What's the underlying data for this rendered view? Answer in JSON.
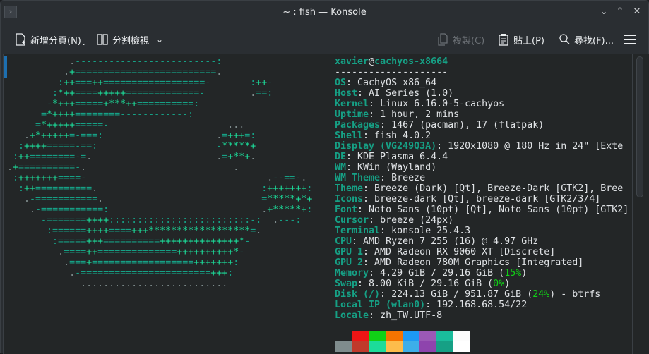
{
  "window": {
    "title": "~ : fish — Konsole",
    "menu_icon": "chevron-right-icon",
    "controls": [
      "minimize",
      "maximize",
      "close"
    ]
  },
  "toolbar": {
    "new_tab": "新增分頁(N)",
    "split_view": "分割檢視",
    "copy": "複製(C)",
    "paste": "貼上(P)",
    "find": "尋找(F)..."
  },
  "art": [
    "           .-------------------------:",
    "          .+=========================.",
    "         :++===++==================-       :++-",
    "        :*++====+++++=============-        .==:",
    "       -*+++=====+***++==========:",
    "      =*++++========------------:",
    "     =*+++++=====-                     ...",
    "   .+*+++++=-===:                    .=+++=:",
    "  :++++=====-==:                     -*****+",
    " :++========-=.                      .=+**+.",
    ".+==========-.                          .",
    " :+++++++====-                                .--==-.",
    "  :++==========.                             :+++++++:",
    "   .-===========.                            =*****+*+",
    "    .-===========:                           .+*****+:",
    "      -=======++++:::::::::::::::::::::::::-:  .---:",
    "       :======++++====+++******************=.",
    "        :=====+++==========++++++++++++++*-",
    "         .====++==============++++++++++*-",
    "          .===+==================+++++++:",
    "           .-=======================+++:",
    "             .........................."
  ],
  "info": {
    "user": "xavier",
    "at": "@",
    "host": "cachyos-x8664",
    "separator": "--------------------",
    "rows": [
      {
        "label": "OS",
        "value": "CachyOS x86_64"
      },
      {
        "label": "Host",
        "value": "AI Series (1.0)"
      },
      {
        "label": "Kernel",
        "value": "Linux 6.16.0-5-cachyos"
      },
      {
        "label": "Uptime",
        "value": "1 hour, 2 mins"
      },
      {
        "label": "Packages",
        "value": "1467 (pacman), 17 (flatpak)"
      },
      {
        "label": "Shell",
        "value": "fish 4.0.2"
      },
      {
        "label": "Display (VG249Q3A)",
        "value": "1920x1080 @ 180 Hz in 24\" [Exte"
      },
      {
        "label": "DE",
        "value": "KDE Plasma 6.4.4"
      },
      {
        "label": "WM",
        "value": "KWin (Wayland)"
      },
      {
        "label": "WM Theme",
        "value": "Breeze"
      },
      {
        "label": "Theme",
        "value": "Breeze (Dark) [Qt], Breeze-Dark [GTK2], Bree"
      },
      {
        "label": "Icons",
        "value": "breeze-dark [Qt], breeze-dark [GTK2/3/4]"
      },
      {
        "label": "Font",
        "value": "Noto Sans (10pt) [Qt], Noto Sans (10pt) [GTK2]"
      },
      {
        "label": "Cursor",
        "value": "breeze (24px)"
      },
      {
        "label": "Terminal",
        "value": "konsole 25.4.3"
      },
      {
        "label": "CPU",
        "value": "AMD Ryzen 7 255 (16) @ 4.97 GHz"
      },
      {
        "label": "GPU 1",
        "value": "AMD Radeon RX 9060 XT [Discrete]"
      },
      {
        "label": "GPU 2",
        "value": "AMD Radeon 780M Graphics [Integrated]"
      },
      {
        "label": "Memory",
        "value": "4.29 GiB / 29.16 GiB (",
        "pct": "15%",
        "tail": ")"
      },
      {
        "label": "Swap",
        "value": "8.00 KiB / 29.16 GiB (",
        "pct": "0%",
        "tail": ")"
      },
      {
        "label": "Disk (/)",
        "value": "224.13 GiB / 951.87 GiB (",
        "pct": "24%",
        "tail": ") - btrfs"
      },
      {
        "label": "Local IP (wlan0)",
        "value": "192.168.68.54/22"
      },
      {
        "label": "Locale",
        "value": "zh_TW.UTF-8"
      }
    ]
  },
  "palette": {
    "row1": [
      "#232627",
      "#ed1515",
      "#11d116",
      "#f67400",
      "#1d99f3",
      "#9b59b6",
      "#1abc9c",
      "#fcfcfc"
    ],
    "row2": [
      "#7f8c8d",
      "#c0392b",
      "#1cdc9a",
      "#fdbc4b",
      "#3daee9",
      "#8e44ad",
      "#16a085",
      "#ffffff"
    ]
  }
}
